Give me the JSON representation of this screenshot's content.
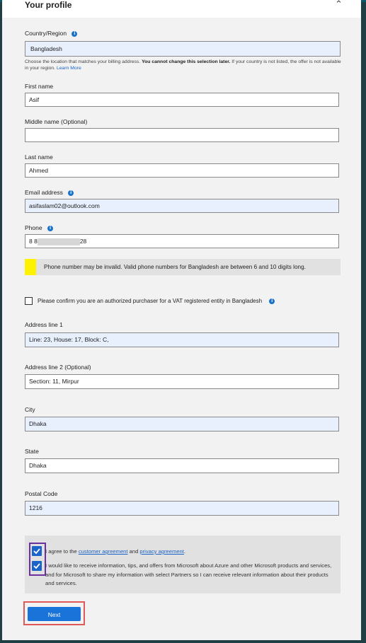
{
  "header": {
    "title": "Your profile",
    "collapse_icon": "chevron-up-icon"
  },
  "country": {
    "label": "Country/Region",
    "value": "Bangladesh",
    "hint_prefix": "Choose the location that matches your billing address. ",
    "hint_bold": "You cannot change this selection later.",
    "hint_suffix": " If your country is not listed, the offer is not available in your region. ",
    "hint_link": "Learn More"
  },
  "first_name": {
    "label": "First name",
    "value": "Asif"
  },
  "middle_name": {
    "label": "Middle name (Optional)",
    "value": ""
  },
  "last_name": {
    "label": "Last name",
    "value": "Ahmed"
  },
  "email": {
    "label": "Email address",
    "value": "asifaslam02@outlook.com"
  },
  "phone": {
    "label": "Phone",
    "value_start": "8 8",
    "value_end": "28"
  },
  "phone_warning": "Phone number may be invalid. Valid phone numbers for Bangladesh are between 6 and 10 digits long.",
  "vat_confirm": {
    "label": "Please confirm you are an authorized purchaser for a VAT registered entity in Bangladesh",
    "checked": false
  },
  "address1": {
    "label": "Address line 1",
    "value": "Line: 23, House: 17, Block: C,"
  },
  "address2": {
    "label": "Address line 2 (Optional)",
    "value": "Section: 11, Mirpur"
  },
  "city": {
    "label": "City",
    "value": "Dhaka"
  },
  "state": {
    "label": "State",
    "value": "Dhaka"
  },
  "postal": {
    "label": "Postal Code",
    "value": "1216"
  },
  "agreement": {
    "prefix": "I agree to the ",
    "customer_link": "customer agreement",
    "and": " and ",
    "privacy_link": "privacy agreement",
    "suffix": ".",
    "checked": true
  },
  "marketing": {
    "text": "I would like to receive information, tips, and offers from Microsoft about Azure and other Microsoft products and services, and for Microsoft to share my information with select Partners so I can receive relevant information about their products and services.",
    "checked": true
  },
  "next_button": "Next",
  "colors": {
    "accent": "#1a73d9",
    "warning": "#fff200",
    "highlight_red": "#e05a5a",
    "highlight_purple": "#6b2fa0"
  }
}
